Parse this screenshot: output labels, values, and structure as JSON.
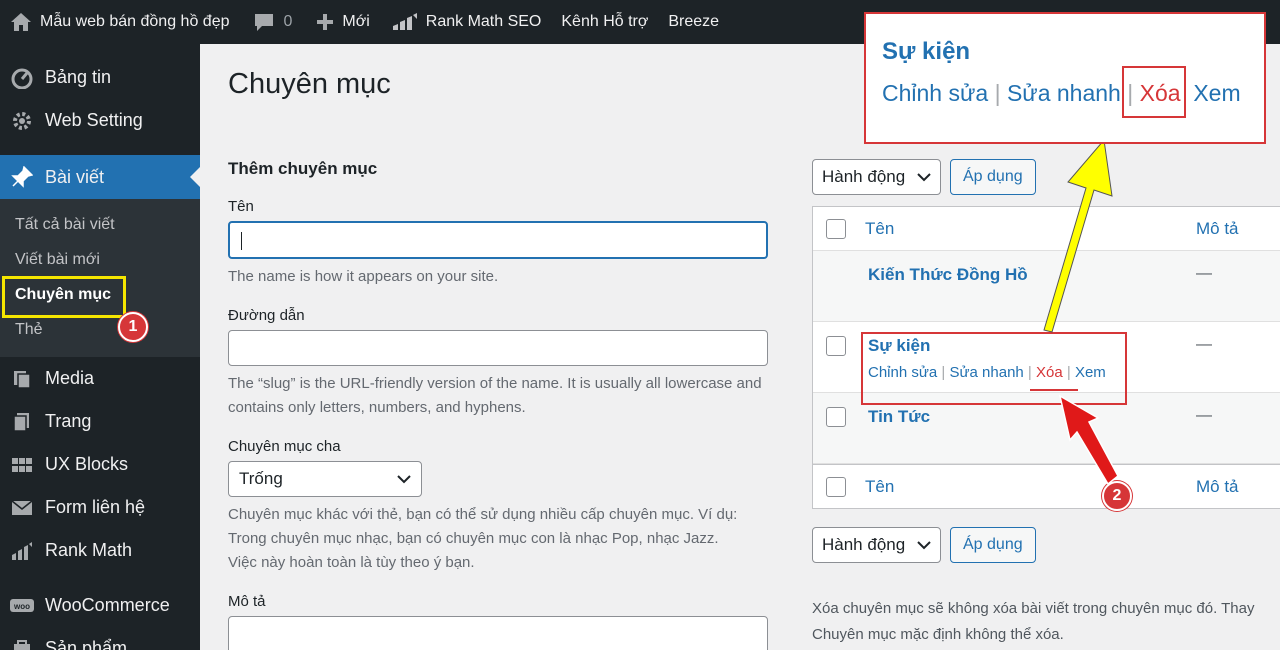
{
  "adminbar": {
    "site_name": "Mẫu web bán đồng hồ đẹp",
    "comments_count": "0",
    "new_label": "Mới",
    "rankmath_label": "Rank Math SEO",
    "support_label": "Kênh Hỗ trợ",
    "breeze_label": "Breeze"
  },
  "sidebar": {
    "items": [
      {
        "label": "Bảng tin",
        "icon": "dashboard-icon"
      },
      {
        "label": "Web Setting",
        "icon": "gear-icon"
      },
      {
        "label": "Bài viết",
        "icon": "pin-icon"
      },
      {
        "label": "Media",
        "icon": "media-icon"
      },
      {
        "label": "Trang",
        "icon": "pages-icon"
      },
      {
        "label": "UX Blocks",
        "icon": "blocks-icon"
      },
      {
        "label": "Form liên hệ",
        "icon": "mail-icon"
      },
      {
        "label": "Rank Math",
        "icon": "chart-icon"
      },
      {
        "label": "WooCommerce",
        "icon": "woo-icon"
      },
      {
        "label": "Sản phẩm",
        "icon": "product-icon"
      }
    ],
    "submenu": [
      "Tất cả bài viết",
      "Viết bài mới",
      "Chuyên mục",
      "Thẻ"
    ]
  },
  "page": {
    "title": "Chuyên mục"
  },
  "form": {
    "heading": "Thêm chuyên mục",
    "name_label": "Tên",
    "name_help": "The name is how it appears on your site.",
    "slug_label": "Đường dẫn",
    "slug_help": "The “slug” is the URL-friendly version of the name. It is usually all lowercase and contains only letters, numbers, and hyphens.",
    "parent_label": "Chuyên mục cha",
    "parent_value": "Trống",
    "parent_help": "Chuyên mục khác với thẻ, bạn có thể sử dụng nhiều cấp chuyên mục. Ví dụ: Trong chuyên mục nhạc, bạn có chuyên mục con là nhạc Pop, nhạc Jazz. Việc này hoàn toàn là tùy theo ý bạn.",
    "desc_label": "Mô tả"
  },
  "table": {
    "bulk_action": "Hành động",
    "apply": "Áp dụng",
    "col_name": "Tên",
    "col_desc": "Mô tả",
    "rows": [
      {
        "name": "Kiến Thức Đồng Hồ",
        "desc": "—"
      },
      {
        "name": "Sự kiện",
        "desc": "—"
      },
      {
        "name": "Tin Tức",
        "desc": "—"
      }
    ],
    "row_actions": {
      "edit": "Chỉnh sửa",
      "quick_edit": "Sửa nhanh",
      "delete": "Xóa",
      "view": "Xem"
    },
    "footnote_1": "Xóa chuyên mục sẽ không xóa bài viết trong chuyên mục đó. Thay",
    "footnote_2": "Chuyên mục mặc định không thể xóa."
  },
  "callout": {
    "title": "Sự kiện",
    "edit": "Chỉnh sửa",
    "quick_edit": "Sửa nhanh",
    "delete": "Xóa",
    "view": "Xem"
  },
  "badges": {
    "one": "1",
    "two": "2"
  },
  "colors": {
    "accent": "#2271b1",
    "danger": "#d63638",
    "highlight": "#f5e600",
    "arrow_yellow": "#ffff00"
  }
}
